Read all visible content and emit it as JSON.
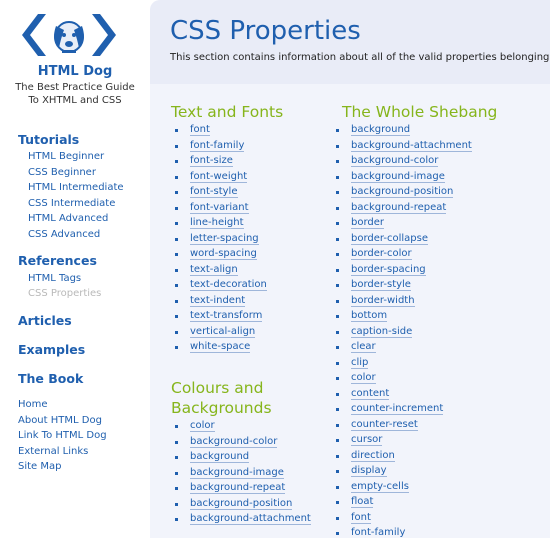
{
  "sidebar": {
    "brand": "HTML Dog",
    "tagline_line1": "The Best Practice Guide",
    "tagline_line2": "To XHTML and CSS",
    "tutorials_heading": "Tutorials",
    "tutorials": [
      "HTML Beginner",
      "CSS Beginner",
      "HTML Intermediate",
      "CSS Intermediate",
      "HTML Advanced",
      "CSS Advanced"
    ],
    "references_heading": "References",
    "references": [
      "HTML Tags",
      "CSS Properties"
    ],
    "articles": "Articles",
    "examples": "Examples",
    "the_book": "The Book",
    "footer_links": [
      "Home",
      "About HTML Dog",
      "Link To HTML Dog",
      "External Links",
      "Site Map"
    ]
  },
  "main": {
    "title": "CSS Properties",
    "intro": "This section contains information about all of the valid properties belonging to",
    "text_fonts_title": "Text and Fonts",
    "text_fonts": [
      "font",
      "font-family",
      "font-size",
      "font-weight",
      "font-style",
      "font-variant",
      "line-height",
      "letter-spacing",
      "word-spacing",
      "text-align",
      "text-decoration",
      "text-indent",
      "text-transform",
      "vertical-align",
      "white-space"
    ],
    "colours_title_line1": "Colours and",
    "colours_title_line2": "Backgrounds",
    "colours": [
      "color",
      "background-color",
      "background",
      "background-image",
      "background-repeat",
      "background-position",
      "background-attachment"
    ],
    "shebang_title": "The Whole Shebang",
    "shebang": [
      "background",
      "background-attachment",
      "background-color",
      "background-image",
      "background-position",
      "background-repeat",
      "border",
      "border-collapse",
      "border-color",
      "border-spacing",
      "border-style",
      "border-width",
      "bottom",
      "caption-side",
      "clear",
      "clip",
      "color",
      "content",
      "counter-increment",
      "counter-reset",
      "cursor",
      "direction",
      "display",
      "empty-cells",
      "float",
      "font",
      "font-family"
    ]
  },
  "colors": {
    "link": "#1f5fae",
    "section_heading": "#86b51c",
    "content_bg": "#f2f4fb",
    "current_nav": "#b9b9b9"
  }
}
